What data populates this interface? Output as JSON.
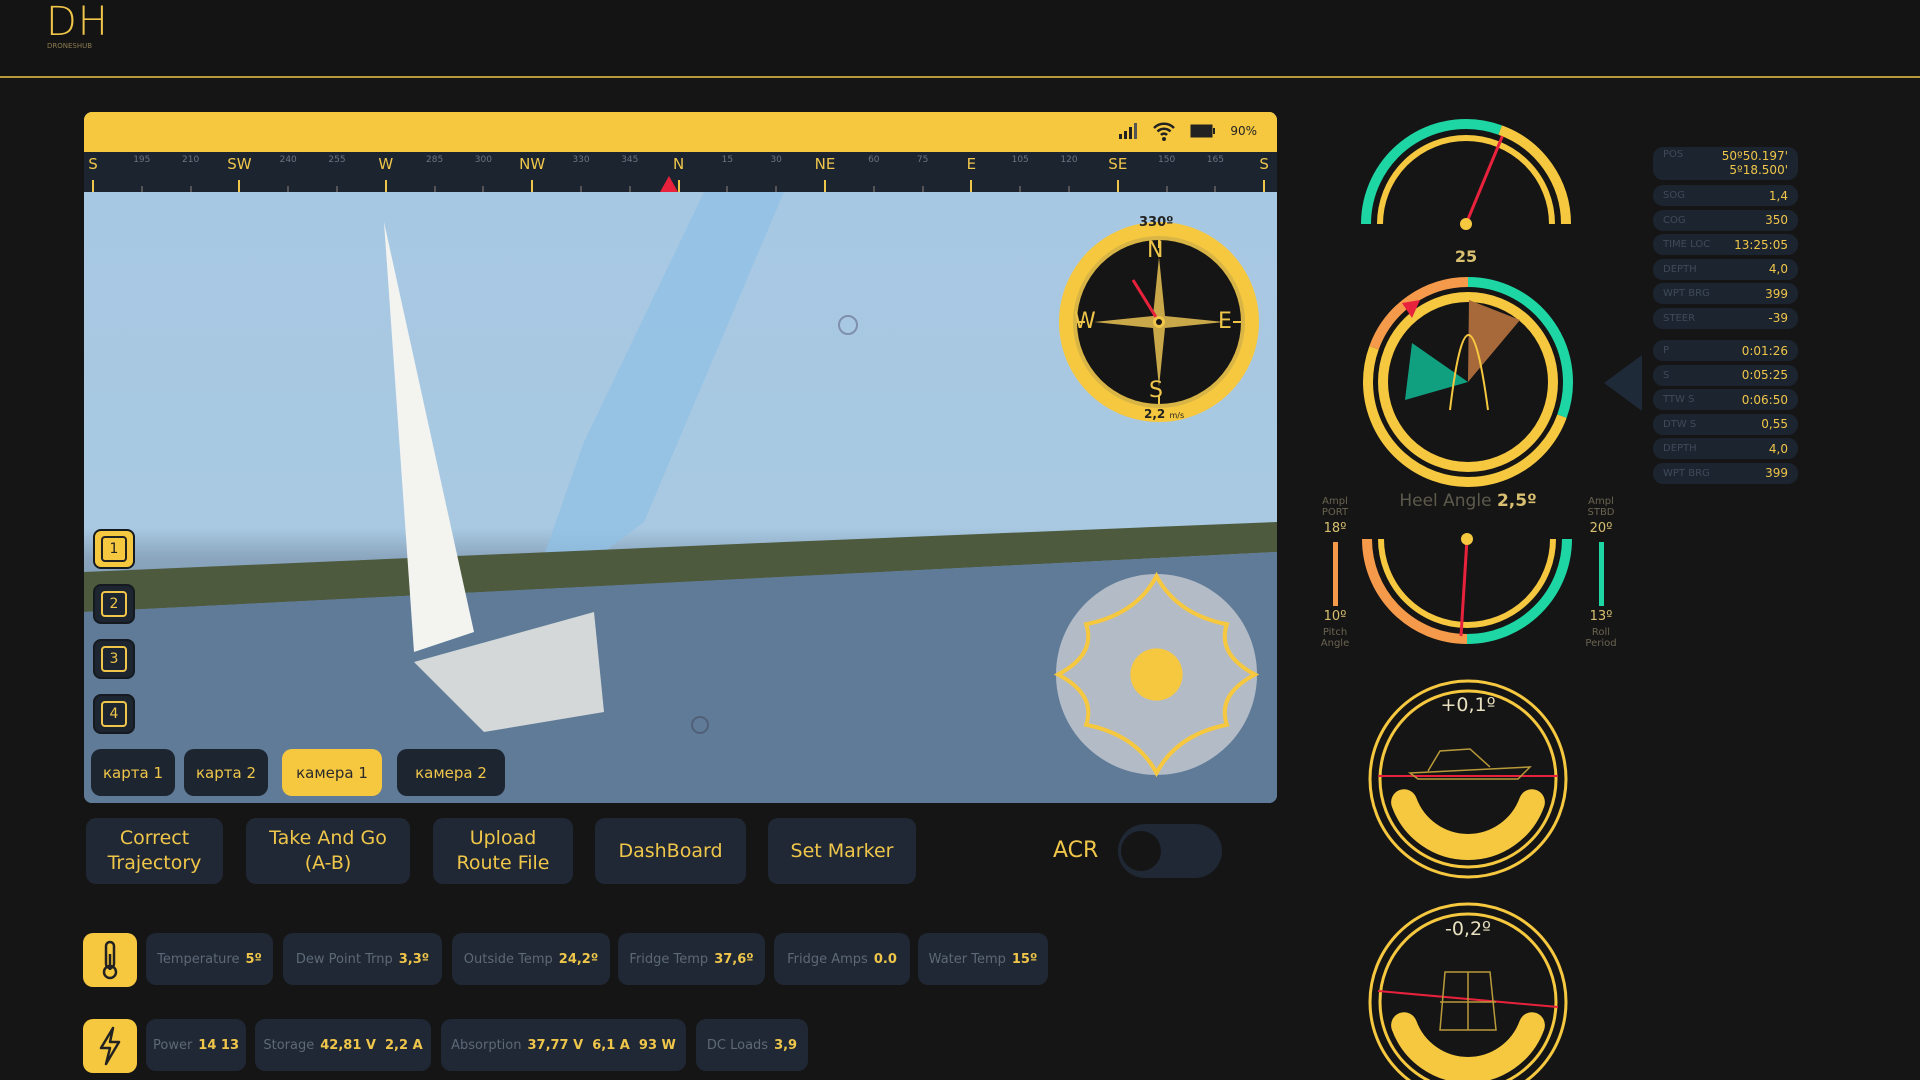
{
  "header": {
    "logo": "DH",
    "logo_sub": "DRONESHUB"
  },
  "status": {
    "battery": "90%",
    "icons": [
      "signal-icon",
      "wifi-icon",
      "battery-icon"
    ]
  },
  "heading_strip": [
    "S",
    "195",
    "210",
    "SW",
    "240",
    "255",
    "W",
    "285",
    "300",
    "NW",
    "330",
    "345",
    "N",
    "15",
    "30",
    "NE",
    "60",
    "75",
    "E",
    "105",
    "120",
    "SE",
    "150",
    "165",
    "S"
  ],
  "compass": {
    "heading": "330º",
    "speed": "2,2",
    "speed_unit": "m/s",
    "cardinals": [
      "N",
      "E",
      "S",
      "W"
    ]
  },
  "view_numbers": [
    "1",
    "2",
    "3",
    "4"
  ],
  "active_view": "1",
  "sources": [
    {
      "label": "карта 1",
      "active": false
    },
    {
      "label": "карта 2",
      "active": false
    },
    {
      "label": "камера 1",
      "active": true
    },
    {
      "label": "камера 2",
      "active": false
    }
  ],
  "actions": [
    {
      "label": "Correct\nTrajectory"
    },
    {
      "label": "Take And Go\n(A-B)"
    },
    {
      "label": "Upload\nRoute File"
    },
    {
      "label": "DashBoard"
    },
    {
      "label": "Set Marker"
    }
  ],
  "acr": {
    "label": "ACR",
    "on": false
  },
  "sensors_temp": [
    {
      "label": "Temperature",
      "value": "5º"
    },
    {
      "label": "Dew Point Trnp",
      "value": "3,3º"
    },
    {
      "label": "Outside Temp",
      "value": "24,2º"
    },
    {
      "label": "Fridge Temp",
      "value": "37,6º"
    },
    {
      "label": "Fridge Amps",
      "value": "0.0"
    },
    {
      "label": "Water Temp",
      "value": "15º"
    }
  ],
  "sensors_power": [
    {
      "label": "Power",
      "value": "14 13"
    },
    {
      "label": "Storage",
      "value": "42,81 V  2,2 A"
    },
    {
      "label": "Absorption",
      "value": "37,77 V  6,1 A  93 W"
    },
    {
      "label": "DC Loads",
      "value": "3,9"
    }
  ],
  "nav_data": {
    "pos_label": "POS",
    "pos_lat": "50º50.197'",
    "pos_lon": "5º18.500'",
    "group1": [
      {
        "k": "SOG",
        "v": "1,4"
      },
      {
        "k": "COG",
        "v": "350"
      },
      {
        "k": "TIME LOC",
        "v": "13:25:05"
      },
      {
        "k": "DEPTH",
        "v": "4,0"
      },
      {
        "k": "WPT BRG",
        "v": "399"
      },
      {
        "k": "STEER",
        "v": "-39"
      }
    ],
    "group2": [
      {
        "k": "P",
        "v": "0:01:26"
      },
      {
        "k": "S",
        "v": "0:05:25"
      },
      {
        "k": "TTW S",
        "v": "0:06:50"
      },
      {
        "k": "DTW S",
        "v": "0,55"
      },
      {
        "k": "DEPTH",
        "v": "4,0"
      },
      {
        "k": "WPT BRG",
        "v": "399"
      }
    ]
  },
  "wind_gauge": {
    "value": "25",
    "max": 40
  },
  "heel": {
    "label": "Heel Angle",
    "value": "2,5º"
  },
  "roll": {
    "port_label": "Ampl\nPORT",
    "port_value": "18º",
    "pitch_value": "10º",
    "pitch_label": "Pitch\nAngle",
    "stbd_label": "Ampl\nSTBD",
    "stbd_value": "20º",
    "roll_value": "13º",
    "roll_label": "Roll\nPeriod"
  },
  "trim_pitch": "+0,1º",
  "trim_roll": "-0,2º",
  "colors": {
    "accent": "#f6c840",
    "panel": "#1f2834",
    "green": "#1ed6a4",
    "orange": "#f49a4a",
    "needle": "#e8223c"
  }
}
